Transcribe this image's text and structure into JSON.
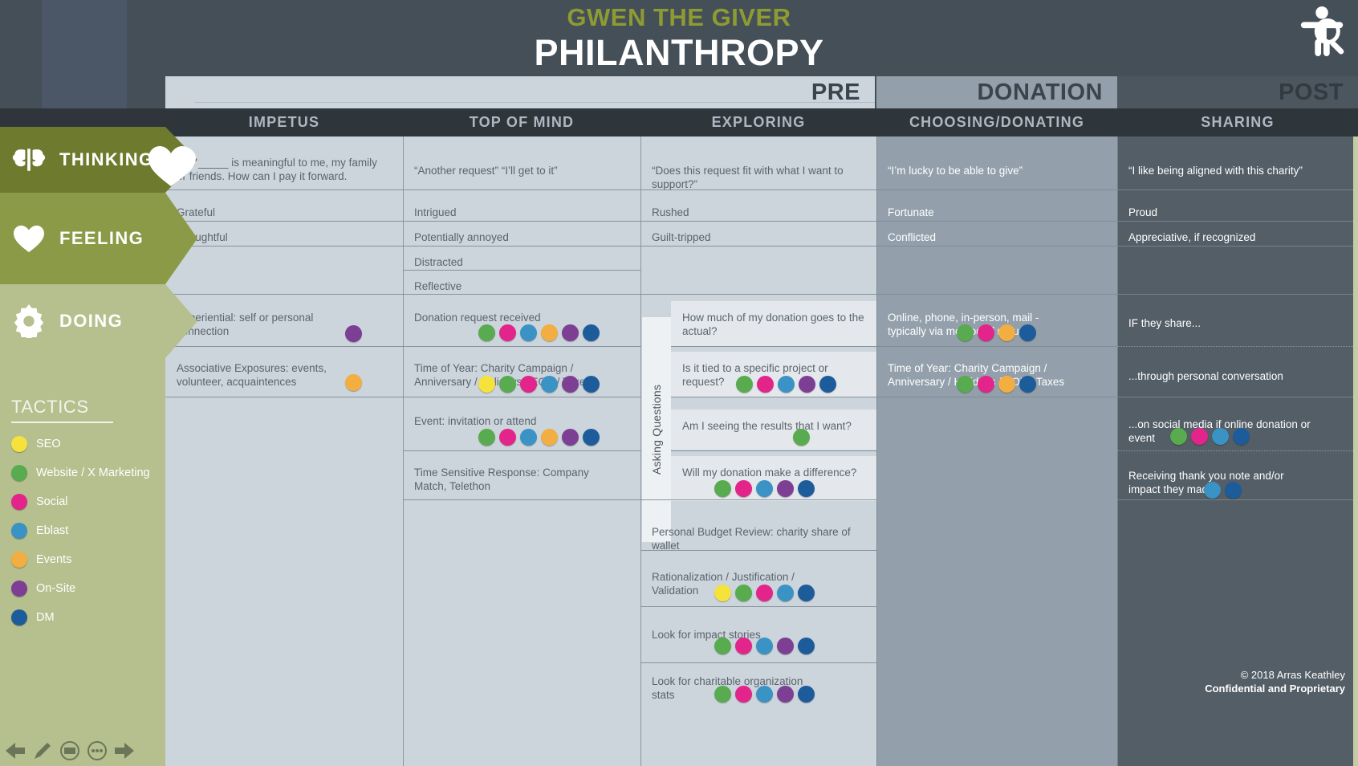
{
  "header": {
    "brand": "GWEN THE GIVER",
    "title": "PHILANTHROPY",
    "persona_icon": "persona-search-icon"
  },
  "phases": [
    {
      "label": "PRE"
    },
    {
      "label": "DONATION"
    },
    {
      "label": "POST"
    }
  ],
  "stages": [
    {
      "label": "IMPETUS"
    },
    {
      "label": "TOP OF MIND"
    },
    {
      "label": "EXPLORING"
    },
    {
      "label": "CHOOSING/DONATING"
    },
    {
      "label": "SHARING"
    }
  ],
  "rows": [
    {
      "label": "THINKING",
      "icon": "brain-icon"
    },
    {
      "label": "FEELING",
      "icon": "heart-icon"
    },
    {
      "label": "DOING",
      "icon": "gear-icon"
    }
  ],
  "asking_questions_label": "Asking Questions",
  "tactics": {
    "title": "TACTICS",
    "items": [
      {
        "label": "SEO",
        "color": "#f5e33c"
      },
      {
        "label": "Website / X Marketing",
        "color": "#58ab4e"
      },
      {
        "label": "Social",
        "color": "#e3248a"
      },
      {
        "label": "Eblast",
        "color": "#3a93c4"
      },
      {
        "label": "Events",
        "color": "#f3ae41"
      },
      {
        "label": "On-Site",
        "color": "#7d3f93"
      },
      {
        "label": "DM",
        "color": "#1d5c9b"
      }
    ]
  },
  "thinking": {
    "impetus": "The _____ is meaningful to me, my family or friends.  How can I pay it forward.",
    "top_of_mind": "“Another request” “I’ll get to it”",
    "exploring": "“Does this request fit with what I want to support?”",
    "donating": "“I’m lucky to be able to give”",
    "sharing": "“I like being aligned with this charity”"
  },
  "feeling": {
    "impetus": [
      "Grateful",
      "Thoughtful"
    ],
    "top_of_mind": [
      "Intrigued",
      "Potentially annoyed",
      "Distracted",
      "Reflective"
    ],
    "exploring": [
      "Rushed",
      "Guilt-tripped"
    ],
    "donating": [
      "Fortunate",
      "Conflicted"
    ],
    "sharing": [
      "Proud",
      "Appreciative, if recognized"
    ]
  },
  "doing": {
    "impetus": [
      {
        "text": "Experiential: self or personal connection",
        "dots": [
          "#7d3f93"
        ]
      },
      {
        "text": "Associative Exposures: events, volunteer, acquaintences",
        "dots": [
          "#f3ae41"
        ]
      }
    ],
    "top_of_mind": [
      {
        "text": "Donation request received",
        "dots": [
          "#58ab4e",
          "#e3248a",
          "#3a93c4",
          "#f3ae41",
          "#7d3f93",
          "#1d5c9b"
        ]
      },
      {
        "text": "Time of Year: Charity Campaign / Anniversary / Holidays / EOY / Taxes",
        "dots": [
          "#f5e33c",
          "#58ab4e",
          "#e3248a",
          "#3a93c4",
          "#7d3f93",
          "#1d5c9b"
        ]
      },
      {
        "text": "Event: invitation or attend",
        "dots": [
          "#58ab4e",
          "#e3248a",
          "#3a93c4",
          "#f3ae41",
          "#7d3f93",
          "#1d5c9b"
        ]
      },
      {
        "text": "Time Sensitive Response: Company Match, Telethon",
        "dots": []
      }
    ],
    "exploring": [
      {
        "text": "How much of my donation goes to the actual?",
        "dots": [],
        "question": true
      },
      {
        "text": "Is it tied to a specific project or request?",
        "dots": [
          "#58ab4e",
          "#e3248a",
          "#3a93c4",
          "#7d3f93",
          "#1d5c9b"
        ],
        "question": true
      },
      {
        "text": "Am I seeing the results that I want?",
        "dots": [
          "#58ab4e"
        ],
        "question": true
      },
      {
        "text": "Will my donation make a difference?",
        "dots": [
          "#58ab4e",
          "#e3248a",
          "#3a93c4",
          "#7d3f93",
          "#1d5c9b"
        ],
        "question": true
      },
      {
        "text": "Personal Budget Review: charity share of wallet",
        "dots": [],
        "question": false
      },
      {
        "text": "Rationalization / Justification / Validation",
        "dots": [
          "#f5e33c",
          "#58ab4e",
          "#e3248a",
          "#3a93c4",
          "#1d5c9b"
        ],
        "question": false
      },
      {
        "text": "Look for impact stories",
        "dots": [
          "#58ab4e",
          "#e3248a",
          "#3a93c4",
          "#7d3f93",
          "#1d5c9b"
        ],
        "question": false
      },
      {
        "text": "Look for charitable organization stats",
        "dots": [
          "#58ab4e",
          "#e3248a",
          "#3a93c4",
          "#7d3f93",
          "#1d5c9b"
        ],
        "question": false
      }
    ],
    "donating": [
      {
        "text": "Online, phone, in-person, mail - typically via method of request",
        "dots": [
          "#58ab4e",
          "#e3248a",
          "#f3ae41",
          "#1d5c9b"
        ]
      },
      {
        "text": "Time of Year: Charity Campaign / Anniversary / Holidays / EOY / Taxes",
        "dots": [
          "#58ab4e",
          "#e3248a",
          "#f3ae41",
          "#1d5c9b"
        ]
      }
    ],
    "sharing": [
      {
        "text": "IF they share...",
        "dots": []
      },
      {
        "text": "...through personal conversation",
        "dots": []
      },
      {
        "text": "...on social media if online donation or event",
        "dots": [
          "#58ab4e",
          "#e3248a",
          "#3a93c4",
          "#1d5c9b"
        ]
      },
      {
        "text": "Receiving thank you note and/or impact they made",
        "dots": [
          "#3a93c4",
          "#1d5c9b"
        ]
      }
    ]
  },
  "footer": {
    "copyright": "© 2018 Arras Keathley",
    "confidential": "Confidential and Proprietary"
  },
  "toolbar": [
    {
      "name": "back-arrow-icon"
    },
    {
      "name": "pencil-icon"
    },
    {
      "name": "keyboard-icon"
    },
    {
      "name": "more-icon"
    },
    {
      "name": "forward-arrow-icon"
    }
  ]
}
